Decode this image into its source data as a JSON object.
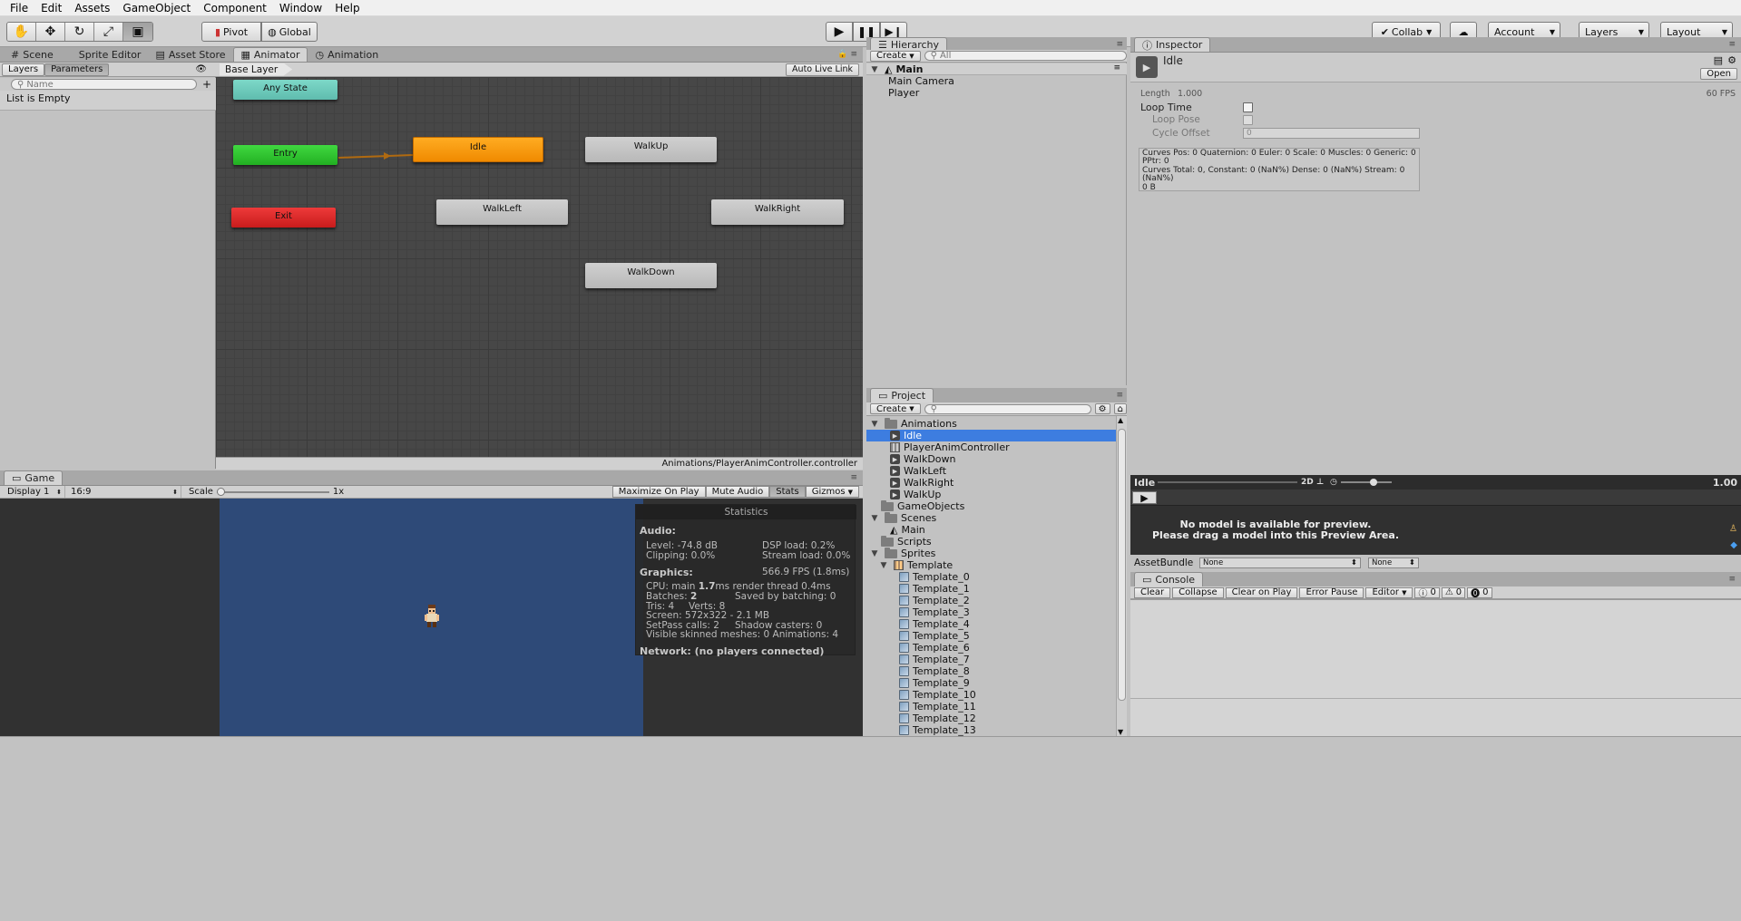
{
  "menu": [
    "File",
    "Edit",
    "Assets",
    "GameObject",
    "Component",
    "Window",
    "Help"
  ],
  "toolbar": {
    "pivot": "Pivot",
    "global": "Global",
    "collab": "Collab",
    "account": "Account",
    "layers": "Layers",
    "layout": "Layout"
  },
  "animator": {
    "tabs": [
      "Scene",
      "Sprite Editor",
      "Asset Store",
      "Animator",
      "Animation"
    ],
    "left_tabs": [
      "Layers",
      "Parameters"
    ],
    "search_placeholder": "Name",
    "empty_text": "List is Empty",
    "breadcrumb": "Base Layer",
    "auto_live_link": "Auto Live Link",
    "footer_path": "Animations/PlayerAnimController.controller",
    "nodes": {
      "any_state": "Any State",
      "entry": "Entry",
      "exit": "Exit",
      "idle": "Idle",
      "walk_up": "WalkUp",
      "walk_left": "WalkLeft",
      "walk_right": "WalkRight",
      "walk_down": "WalkDown"
    },
    "colors": {
      "any_state": "#6cc8b8",
      "entry": "#2fc62f",
      "exit": "#e02a2a",
      "default": "#ff9f10",
      "state": "#c4c4c4"
    }
  },
  "hierarchy": {
    "tab": "Hierarchy",
    "create": "Create",
    "search": "All",
    "scene": "Main",
    "items": [
      "Main Camera",
      "Player"
    ]
  },
  "project": {
    "tab": "Project",
    "create": "Create",
    "tree": {
      "animations": "Animations",
      "anim_items": [
        "Idle",
        "PlayerAnimController",
        "WalkDown",
        "WalkLeft",
        "WalkRight",
        "WalkUp"
      ],
      "gameobjects": "GameObjects",
      "scenes": "Scenes",
      "scene_main": "Main",
      "scripts": "Scripts",
      "sprites": "Sprites",
      "template": "Template",
      "templates": [
        "Template_0",
        "Template_1",
        "Template_2",
        "Template_3",
        "Template_4",
        "Template_5",
        "Template_6",
        "Template_7",
        "Template_8",
        "Template_9",
        "Template_10",
        "Template_11",
        "Template_12",
        "Template_13"
      ]
    }
  },
  "inspector": {
    "tab": "Inspector",
    "title": "Idle",
    "open": "Open",
    "length_label": "Length",
    "length_value": "1.000",
    "fps": "60 FPS",
    "loop_time": "Loop Time",
    "loop_pose": "Loop Pose",
    "cycle_offset": "Cycle Offset",
    "cycle_value": "0",
    "info_lines": [
      "Curves Pos: 0 Quaternion: 0 Euler: 0 Scale: 0 Muscles: 0 Generic: 0",
      "PPtr: 0",
      "Curves Total: 0, Constant: 0 (NaN%) Dense: 0 (NaN%) Stream: 0",
      "(NaN%)",
      "0 B"
    ],
    "preview_title": "Idle",
    "preview_2d": "2D",
    "preview_speed": "1.00",
    "preview_msg1": "No model is available for preview.",
    "preview_msg2": "Please drag a model into this Preview Area.",
    "assetbundle": "AssetBundle",
    "none1": "None",
    "none2": "None"
  },
  "console": {
    "tab": "Console",
    "buttons": [
      "Clear",
      "Collapse",
      "Clear on Play",
      "Error Pause",
      "Editor"
    ],
    "counts": [
      "0",
      "0",
      "0"
    ]
  },
  "game": {
    "tab": "Game",
    "display": "Display 1",
    "aspect": "16:9",
    "scale_label": "Scale",
    "scale_value": "1x",
    "buttons": [
      "Maximize On Play",
      "Mute Audio",
      "Stats",
      "Gizmos"
    ],
    "bg_color": "#2e4a78",
    "stats": {
      "title": "Statistics",
      "audio": "Audio:",
      "level": "Level: -74.8 dB",
      "clipping": "Clipping: 0.0%",
      "dsp": "DSP load: 0.2%",
      "stream": "Stream load: 0.0%",
      "graphics": "Graphics:",
      "fps": "566.9 FPS (1.8ms)",
      "cpu_prefix": "CPU: main ",
      "cpu_main": "1.7",
      "cpu_suffix": "ms  render thread 0.4ms",
      "batches_prefix": "Batches: ",
      "batches": "2",
      "saved": "Saved by batching: 0",
      "tris": "Tris: 4",
      "verts": "Verts: 8",
      "screen": "Screen: 572x322 - 2.1 MB",
      "setpass": "SetPass calls: 2",
      "shadow": "Shadow casters: 0",
      "visible": "Visible skinned meshes: 0  Animations: 4",
      "network": "Network: (no players connected)"
    }
  }
}
